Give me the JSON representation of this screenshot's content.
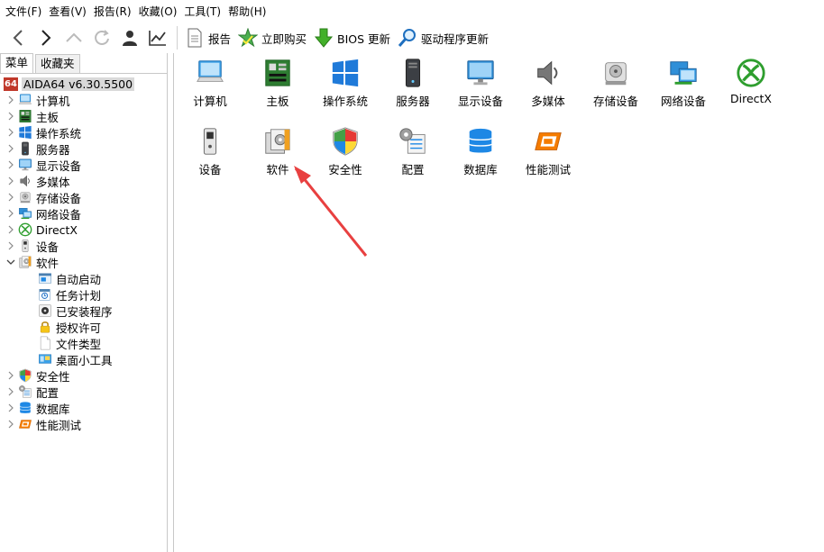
{
  "menu": [
    "文件(F)",
    "查看(V)",
    "报告(R)",
    "收藏(O)",
    "工具(T)",
    "帮助(H)"
  ],
  "toolbar": {
    "report": "报告",
    "buy": "立即购买",
    "bios": "BIOS 更新",
    "driver": "驱动程序更新"
  },
  "tabs": [
    "菜单",
    "收藏夹"
  ],
  "tree": {
    "root": "AIDA64 v6.30.5500",
    "items": [
      {
        "label": "计算机",
        "icon": "computer-icon",
        "expanded": false
      },
      {
        "label": "主板",
        "icon": "motherboard-icon",
        "expanded": false
      },
      {
        "label": "操作系统",
        "icon": "windows-icon",
        "expanded": false
      },
      {
        "label": "服务器",
        "icon": "server-icon",
        "expanded": false
      },
      {
        "label": "显示设备",
        "icon": "monitor-icon",
        "expanded": false
      },
      {
        "label": "多媒体",
        "icon": "speaker-icon",
        "expanded": false
      },
      {
        "label": "存储设备",
        "icon": "storage-icon",
        "expanded": false
      },
      {
        "label": "网络设备",
        "icon": "network-icon",
        "expanded": false
      },
      {
        "label": "DirectX",
        "icon": "xbox-icon",
        "expanded": false
      },
      {
        "label": "设备",
        "icon": "device-icon",
        "expanded": false
      },
      {
        "label": "软件",
        "icon": "software-icon",
        "expanded": true
      },
      {
        "label": "安全性",
        "icon": "shield-icon",
        "expanded": false
      },
      {
        "label": "配置",
        "icon": "config-icon",
        "expanded": false
      },
      {
        "label": "数据库",
        "icon": "database-icon",
        "expanded": false
      },
      {
        "label": "性能测试",
        "icon": "benchmark-icon",
        "expanded": false
      }
    ],
    "software_children": [
      {
        "label": "自动启动",
        "icon": "autostart-icon"
      },
      {
        "label": "任务计划",
        "icon": "task-schedule-icon"
      },
      {
        "label": "已安装程序",
        "icon": "installed-programs-icon"
      },
      {
        "label": "授权许可",
        "icon": "license-lock-icon"
      },
      {
        "label": "文件类型",
        "icon": "file-type-icon"
      },
      {
        "label": "桌面小工具",
        "icon": "gadget-icon"
      }
    ]
  },
  "grid": [
    {
      "label": "计算机",
      "icon": "computer-icon"
    },
    {
      "label": "主板",
      "icon": "motherboard-icon"
    },
    {
      "label": "操作系统",
      "icon": "windows-icon"
    },
    {
      "label": "服务器",
      "icon": "server-icon"
    },
    {
      "label": "显示设备",
      "icon": "monitor-icon"
    },
    {
      "label": "多媒体",
      "icon": "speaker-icon"
    },
    {
      "label": "存储设备",
      "icon": "storage-icon"
    },
    {
      "label": "网络设备",
      "icon": "network-icon"
    },
    {
      "label": "DirectX",
      "icon": "xbox-icon"
    },
    {
      "label": "设备",
      "icon": "device-icon"
    },
    {
      "label": "软件",
      "icon": "software-icon"
    },
    {
      "label": "安全性",
      "icon": "shield-icon"
    },
    {
      "label": "配置",
      "icon": "config-icon"
    },
    {
      "label": "数据库",
      "icon": "database-icon"
    },
    {
      "label": "性能测试",
      "icon": "benchmark-icon"
    }
  ],
  "colors": {
    "accent_red": "#e8433a",
    "win_blue": "#1f7ad9",
    "xbox_green": "#2e9e2e",
    "arrow_red": "#e84040"
  }
}
